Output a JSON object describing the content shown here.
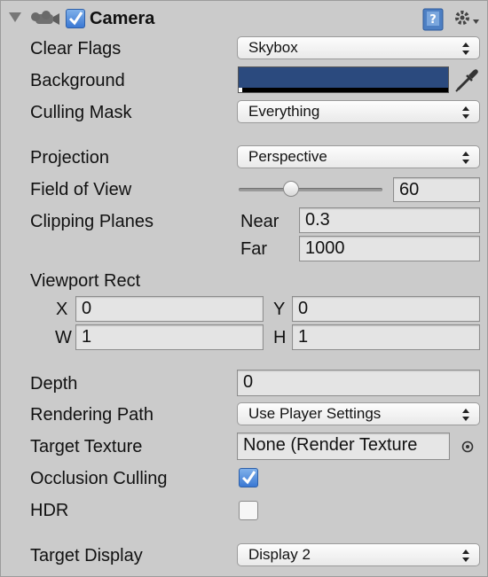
{
  "header": {
    "title": "Camera",
    "enabled": true
  },
  "labels": {
    "clear_flags": "Clear Flags",
    "background": "Background",
    "culling_mask": "Culling Mask",
    "projection": "Projection",
    "field_of_view": "Field of View",
    "clipping_planes": "Clipping Planes",
    "near": "Near",
    "far": "Far",
    "viewport_rect": "Viewport Rect",
    "x": "X",
    "y": "Y",
    "w": "W",
    "h": "H",
    "depth": "Depth",
    "rendering_path": "Rendering Path",
    "target_texture": "Target Texture",
    "occlusion_culling": "Occlusion Culling",
    "hdr": "HDR",
    "target_display": "Target Display"
  },
  "values": {
    "clear_flags": "Skybox",
    "background_color": "#2b4a7e",
    "culling_mask": "Everything",
    "projection": "Perspective",
    "field_of_view": "60",
    "field_of_view_slider_fraction": 0.35,
    "near": "0.3",
    "far": "1000",
    "viewport_x": "0",
    "viewport_y": "0",
    "viewport_w": "1",
    "viewport_h": "1",
    "depth": "0",
    "rendering_path": "Use Player Settings",
    "target_texture": "None (Render Texture",
    "occlusion_culling": true,
    "hdr": false,
    "target_display": "Display 2"
  },
  "icons": {
    "foldout": "foldout-triangle-icon",
    "component": "camera-icon",
    "help": "help-book-icon",
    "settings": "gear-icon",
    "picker": "eyedropper-icon",
    "object_picker": "object-picker-icon"
  }
}
